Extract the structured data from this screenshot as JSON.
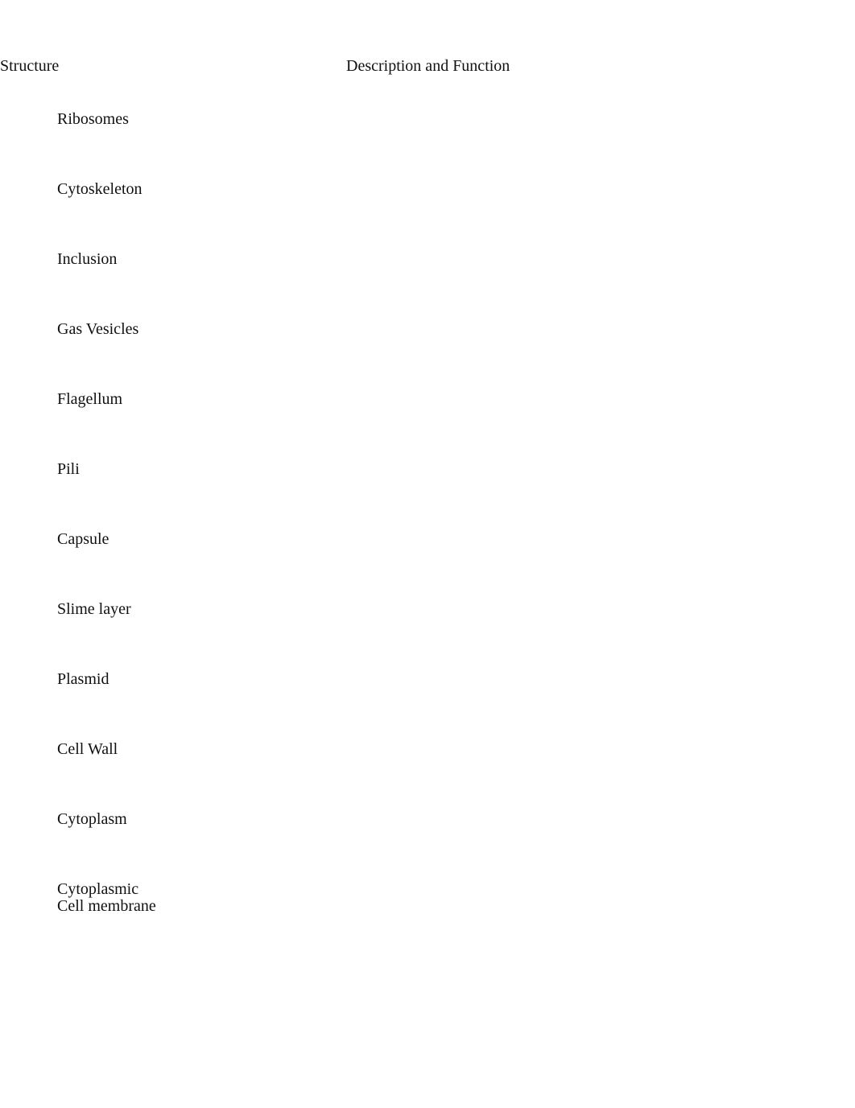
{
  "document": {
    "background_color": "#ffffff",
    "text_color": "#111111"
  },
  "table": {
    "headers": {
      "structure": "Structure",
      "description": "Description and Function"
    },
    "rows": [
      {
        "structure": "Ribosomes",
        "description": ""
      },
      {
        "structure": "Cytoskeleton",
        "description": ""
      },
      {
        "structure": "Inclusion",
        "description": ""
      },
      {
        "structure": "Gas Vesicles",
        "description": ""
      },
      {
        "structure": "Flagellum",
        "description": ""
      },
      {
        "structure": "Pili",
        "description": ""
      },
      {
        "structure": "Capsule",
        "description": ""
      },
      {
        "structure": "Slime layer",
        "description": ""
      },
      {
        "structure": "Plasmid",
        "description": ""
      },
      {
        "structure": "Cell Wall",
        "description": ""
      },
      {
        "structure": "Cytoplasm",
        "description": ""
      },
      {
        "structure": "Cytoplasmic\nCell membrane",
        "description": ""
      }
    ]
  }
}
